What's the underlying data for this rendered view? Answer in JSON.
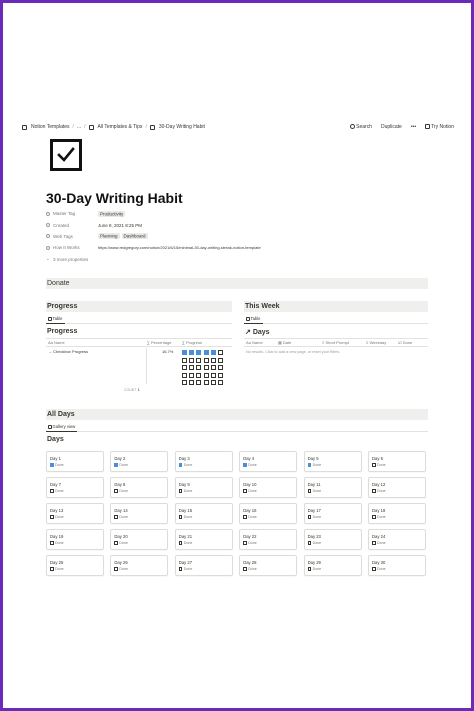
{
  "breadcrumbs": [
    "Notion Templates",
    "...",
    "All Templates & Tips",
    "30-Day Writing Habit"
  ],
  "actions": {
    "search": "Search",
    "duplicate": "Duplicate",
    "more": "•••",
    "try": "Try Notion"
  },
  "page": {
    "icon": "checkbox-icon",
    "title": "30-Day Writing Habit"
  },
  "properties": {
    "master_tag": {
      "label": "Master Tag",
      "value": "Productivity"
    },
    "created": {
      "label": "Created",
      "value": "June 8, 2021 8:25 PM"
    },
    "web_tags": {
      "label": "Web Tags",
      "values": [
        "Planning",
        "Dashboard"
      ]
    },
    "how_it_works": {
      "label": "How It Works",
      "value": "https://www.redgregory.com/notion/2021/6/15/minimal-30-day-writing-streak-notion-template"
    },
    "more": "3 more properties"
  },
  "donate": "Donate",
  "progress": {
    "heading": "Progress",
    "tab": "Table",
    "table_title": "Progress",
    "columns": [
      "Name",
      "Percentage",
      "Progress"
    ],
    "row": {
      "name": "Checkbox Progress",
      "percentage": "16.7%",
      "checked": 5,
      "total": 30
    },
    "count_label": "COUNT",
    "count_value": "1"
  },
  "this_week": {
    "heading": "This Week",
    "tab": "Table",
    "table_title": "Days",
    "columns": [
      "Name",
      "Date",
      "Short Prompt",
      "Weekday",
      "Done"
    ],
    "empty": "No results. Click to add a new page, or reset your filters."
  },
  "all_days": {
    "heading": "All Days",
    "tab": "Gallery view",
    "gallery_title": "Days",
    "done_label": "Done",
    "days": [
      {
        "name": "Day 1",
        "done": true
      },
      {
        "name": "Day 2",
        "done": true
      },
      {
        "name": "Day 3",
        "done": true
      },
      {
        "name": "Day 4",
        "done": true
      },
      {
        "name": "Day 5",
        "done": true
      },
      {
        "name": "Day 6",
        "done": false
      },
      {
        "name": "Day 7",
        "done": false
      },
      {
        "name": "Day 8",
        "done": false
      },
      {
        "name": "Day 9",
        "done": false
      },
      {
        "name": "Day 10",
        "done": false
      },
      {
        "name": "Day 11",
        "done": false
      },
      {
        "name": "Day 12",
        "done": false
      },
      {
        "name": "Day 13",
        "done": false
      },
      {
        "name": "Day 14",
        "done": false
      },
      {
        "name": "Day 15",
        "done": false
      },
      {
        "name": "Day 16",
        "done": false
      },
      {
        "name": "Day 17",
        "done": false
      },
      {
        "name": "Day 18",
        "done": false
      },
      {
        "name": "Day 19",
        "done": false
      },
      {
        "name": "Day 20",
        "done": false
      },
      {
        "name": "Day 21",
        "done": false
      },
      {
        "name": "Day 22",
        "done": false
      },
      {
        "name": "Day 23",
        "done": false
      },
      {
        "name": "Day 24",
        "done": false
      },
      {
        "name": "Day 25",
        "done": false
      },
      {
        "name": "Day 26",
        "done": false
      },
      {
        "name": "Day 27",
        "done": false
      },
      {
        "name": "Day 28",
        "done": false
      },
      {
        "name": "Day 29",
        "done": false
      },
      {
        "name": "Day 30",
        "done": false
      }
    ]
  },
  "colors": {
    "frame": "#6b2bb8",
    "checked": "#4b8fd9",
    "header_bg": "#efefed"
  }
}
